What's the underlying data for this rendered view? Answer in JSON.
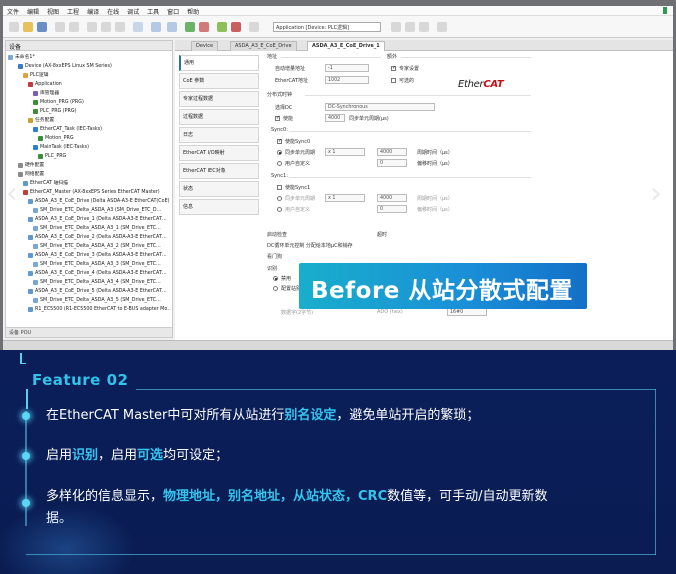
{
  "screenshot": {
    "menubar": [
      "文件",
      "编辑",
      "视图",
      "工程",
      "编译",
      "在线",
      "调试",
      "工具",
      "窗口",
      "帮助"
    ],
    "device_combo": "Application [Device: PLC逻辑]",
    "devices_panel_title": "设备",
    "devices_footer": "设备  POU",
    "tree": [
      {
        "label": "未命名1*",
        "color": "#7aa7d6"
      },
      {
        "label": "Device (AX-8xxEPS Linux SM Series)",
        "color": "#3a7cc2"
      },
      {
        "label": "PLC逻辑",
        "color": "#e2a23b"
      },
      {
        "label": "Application",
        "color": "#c23c3c"
      },
      {
        "label": "库管理器",
        "color": "#7b5cb6"
      },
      {
        "label": "Motion_PRG (PRG)",
        "color": "#3a8e3a"
      },
      {
        "label": "PLC_PRG (PRG)",
        "color": "#3a8e3a"
      },
      {
        "label": "任务配置",
        "color": "#c9a02a"
      },
      {
        "label": "EtherCAT_Task (IEC-Tasks)",
        "color": "#2d7dd2"
      },
      {
        "label": "Motion_PRG",
        "color": "#3a8e3a"
      },
      {
        "label": "MainTask (IEC-Tasks)",
        "color": "#2d7dd2"
      },
      {
        "label": "PLC_PRG",
        "color": "#3a8e3a"
      },
      {
        "label": "硬件配置",
        "color": "#8a8a8a"
      },
      {
        "label": "网络配置",
        "color": "#8a8a8a"
      },
      {
        "label": "EtherCAT 轴扫描",
        "color": "#5c9ad1"
      },
      {
        "label": "EtherCAT_Master (AX-8xxEPS Series EtherCAT Master)",
        "color": "#c23c3c"
      },
      {
        "label": "ASDA_A3_E_CoE_Drive (Delta ASDA-A3-E EtherCAT(CoE)…",
        "color": "#5c9ad1"
      },
      {
        "label": "SM_Drive_ETC_Delta_ASDA_A3 (SM_Drive_ETC_D…",
        "color": "#7aa7d6"
      },
      {
        "label": "ASDA_A3_E_CoE_Drive_1 (Delta ASDA-A3-E EtherCAT…",
        "color": "#5c9ad1"
      },
      {
        "label": "SM_Drive_ETC_Delta_ASDA_A3_1 (SM_Drive_ETC…",
        "color": "#7aa7d6"
      },
      {
        "label": "ASDA_A3_E_CoE_Drive_2 (Delta ASDA-A3-E EtherCAT…",
        "color": "#5c9ad1"
      },
      {
        "label": "SM_Drive_ETC_Delta_ASDA_A3_2 (SM_Drive_ETC…",
        "color": "#7aa7d6"
      },
      {
        "label": "ASDA_A3_E_CoE_Drive_3 (Delta ASDA-A3-E EtherCAT…",
        "color": "#5c9ad1"
      },
      {
        "label": "SM_Drive_ETC_Delta_ASDA_A3_3 (SM_Drive_ETC…",
        "color": "#7aa7d6"
      },
      {
        "label": "ASDA_A3_E_CoE_Drive_4 (Delta ASDA-A3-E EtherCAT…",
        "color": "#5c9ad1"
      },
      {
        "label": "SM_Drive_ETC_Delta_ASDA_A3_4 (SM_Drive_ETC…",
        "color": "#7aa7d6"
      },
      {
        "label": "ASDA_A3_E_CoE_Drive_5 (Delta ASDA-A3-E EtherCAT…",
        "color": "#5c9ad1"
      },
      {
        "label": "SM_Drive_ETC_Delta_ASDA_A3_5 (SM_Drive_ETC…",
        "color": "#7aa7d6"
      },
      {
        "label": "R1_EC5500 (R1-EC5500 EtherCAT to E-BUS adapter Mo…",
        "color": "#5c9ad1"
      }
    ],
    "tabs": [
      "Device",
      "ASDA_A3_E_CoE_Drive",
      "ASDA_A3_E_CoE_Drive_1"
    ],
    "nav_items": [
      "通用",
      "CoE 参数",
      "专家过程数据",
      "过程数据",
      "日志",
      "EtherCAT I/O映射",
      "EtherCAT IEC对象",
      "状态",
      "信息"
    ],
    "form": {
      "address_header": "地址",
      "extra_header": "额外",
      "auto_addr_label": "自动增量地址",
      "auto_addr_value": "-1",
      "ethercat_addr_label": "EtherCAT地址",
      "ethercat_addr_value": "1002",
      "expert_setting": "专家设置",
      "optional": "可选的",
      "dc_header": "分布式时钟",
      "select_dc_label": "选择DC",
      "select_dc_value": "DC-Synchronous",
      "enable_label": "使能",
      "cycle_value": "4000",
      "cycle_unit": "同步单元周期(µs)",
      "sync0_header": "Sync0:",
      "enable_sync0": "使能Sync0",
      "sync_unit_cycle": "同步单元周期",
      "user_defined": "用户自定义",
      "multiplier_value": "x 1",
      "period_value": "4000",
      "period_label": "周期时间（µs）",
      "shift_value": "0",
      "shift_label": "偏移时间（µs）",
      "sync1_header": "Sync1:",
      "enable_sync1": "使能Sync1",
      "startup_check": "启动检查",
      "timeout": "超时",
      "dc_cycle_note": "DC循环单元控制 分配给本地µC和销存",
      "watchdog": "看门狗",
      "identify_header": "识别",
      "disable_label": "禁用",
      "config_station_alias": "配置站别名",
      "data_word": "数据字(2字节)",
      "ado_label": "ADO (hex)",
      "ado_value": "16#0"
    },
    "logo_ether": "Ether",
    "logo_cat": "CAT",
    "banner_text": "Before  从站分散式配置",
    "nav_prev_icon": "‹",
    "nav_next_icon": "›"
  },
  "feature": {
    "title": "Feature 02",
    "accent_color": "#31c3ea",
    "bullets": [
      [
        {
          "t": "在EtherCAT Master中可对所有从站进行",
          "h": false
        },
        {
          "t": "别名设定",
          "h": true
        },
        {
          "t": "，避免单站开启的繁琐；",
          "h": false
        }
      ],
      [
        {
          "t": "启用",
          "h": false
        },
        {
          "t": "识别",
          "h": true
        },
        {
          "t": "，启用",
          "h": false
        },
        {
          "t": "可选",
          "h": true
        },
        {
          "t": "均可设定；",
          "h": false
        }
      ],
      [
        {
          "t": "多样化的信息显示，",
          "h": false
        },
        {
          "t": "物理地址，别名地址，从站状态，CRC",
          "h": true
        },
        {
          "t": "数值等，可手动/自动更新数",
          "h": false
        }
      ],
      [
        {
          "t": "据。",
          "h": false
        }
      ]
    ]
  }
}
